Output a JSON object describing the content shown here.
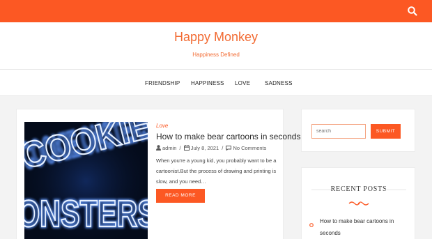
{
  "colors": {
    "accent": "#fc5823",
    "title": "#f26b33"
  },
  "header": {
    "search_icon": "search-icon",
    "site_title": "Happy Monkey",
    "tagline": "Happiness Defined"
  },
  "nav": {
    "items": [
      {
        "label": "FRIENDSHIP"
      },
      {
        "label": "HAPPINESS"
      },
      {
        "label": "LOVE"
      },
      {
        "label": "SADNESS"
      }
    ]
  },
  "post": {
    "image_alt_text": "COOKIE ONSTERS",
    "category": "Love",
    "title": "How to make bear cartoons in seconds",
    "author": "admin",
    "date": "July 8, 2021",
    "comments": "No Comments",
    "excerpt": "When you're a young kid, you probably want to be a cartoonist.But the process of drawing and printing is slow, and you need…",
    "read_more": "READ MORE"
  },
  "sidebar": {
    "search": {
      "placeholder": "search",
      "submit_label": "SUBMIT"
    },
    "recent_posts": {
      "title": "RECENT POSTS",
      "items": [
        {
          "label": "How to make bear cartoons in seconds"
        }
      ]
    }
  }
}
